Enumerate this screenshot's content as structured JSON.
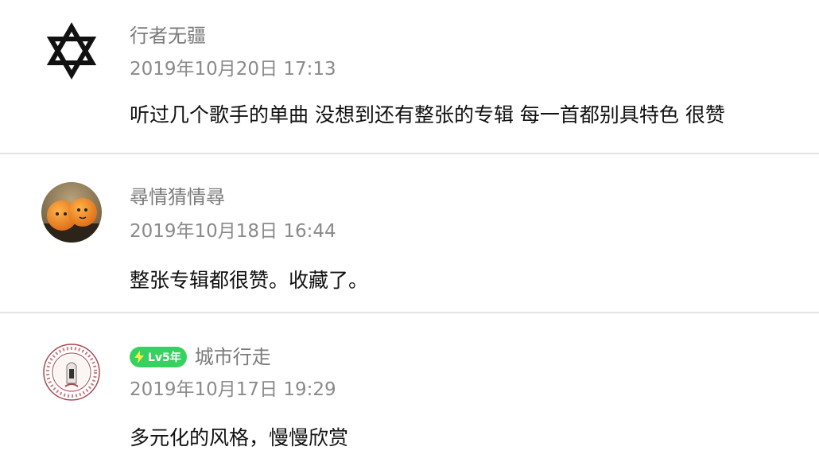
{
  "comments": [
    {
      "avatar": "star-of-david-icon",
      "username": "行者无疆",
      "timestamp": "2019年10月20日 17:13",
      "text": "听过几个歌手的单曲 没想到还有整张的专辑 每一首都别具特色 很赞"
    },
    {
      "avatar": "oranges-avatar",
      "username": "尋情猜情尋",
      "timestamp": "2019年10月18日 16:44",
      "text": "整张专辑都很赞。收藏了。"
    },
    {
      "avatar": "seal-emblem-avatar",
      "badge": "Lv5年",
      "badge_color": "#36d15e",
      "username": "城市行走",
      "timestamp": "2019年10月17日 19:29",
      "text": "多元化的风格，慢慢欣赏"
    }
  ]
}
